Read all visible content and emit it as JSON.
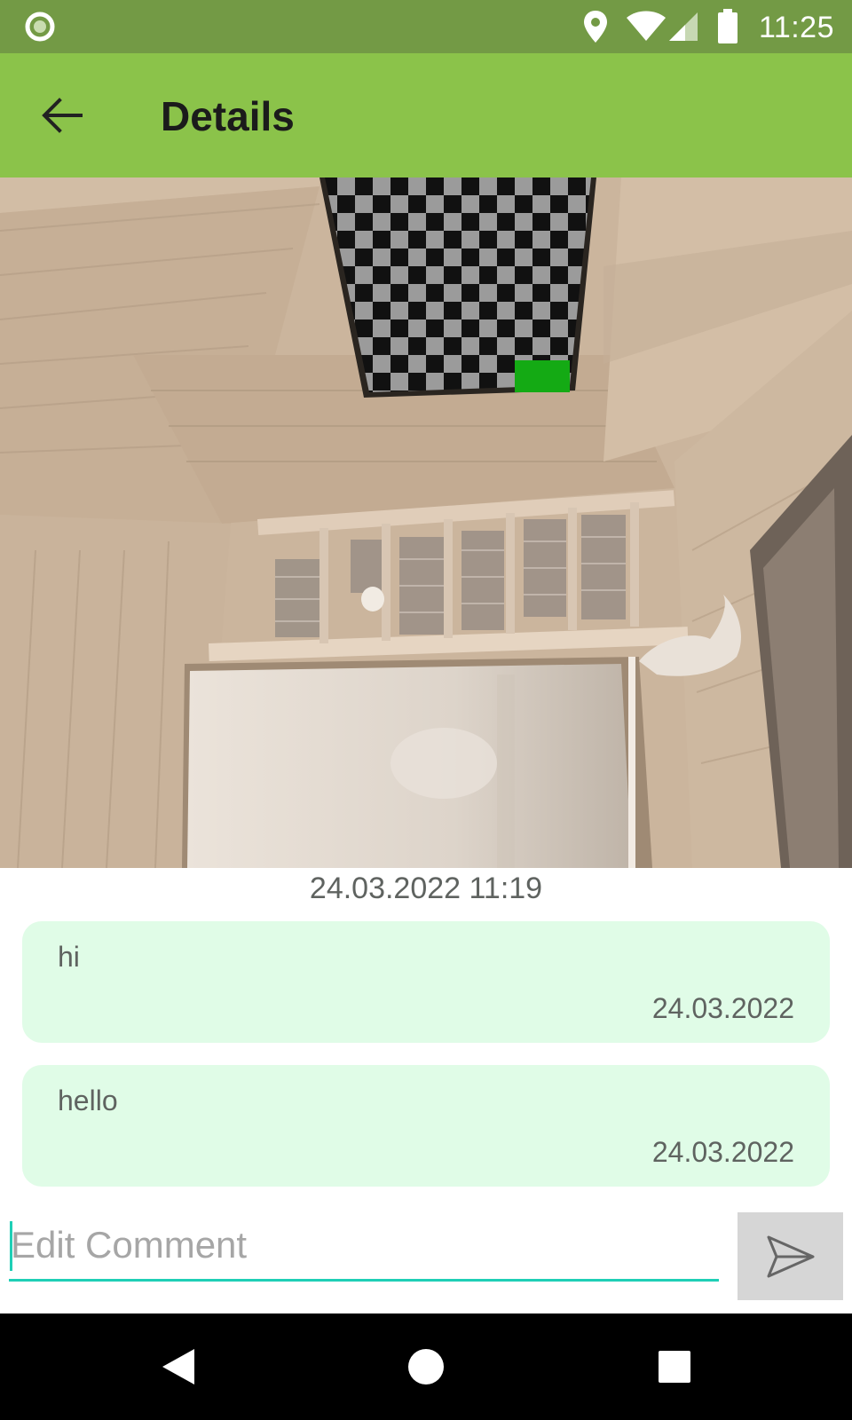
{
  "status_bar": {
    "time": "11:25",
    "icons": [
      "circle-notification-icon",
      "location-pin-icon",
      "wifi-icon",
      "cell-signal-icon",
      "battery-icon"
    ]
  },
  "app_bar": {
    "title": "Details",
    "back_icon": "arrow-back-icon",
    "color": "#8bc34a"
  },
  "photo": {
    "description_icon": "room-photo"
  },
  "photo_date": "24.03.2022 11:19",
  "comments": [
    {
      "text": "hi",
      "date": "24.03.2022"
    },
    {
      "text": "hello",
      "date": "24.03.2022"
    }
  ],
  "input": {
    "placeholder": "Edit Comment",
    "value": ""
  },
  "send_button": {
    "icon": "send-icon"
  },
  "nav_bar": {
    "icons": [
      "back-triangle-icon",
      "home-circle-icon",
      "recents-square-icon"
    ]
  },
  "colors": {
    "status_bar": "#739a45",
    "app_bar": "#8bc34a",
    "card": "#e0fce7",
    "accent": "#1fcfb6"
  }
}
